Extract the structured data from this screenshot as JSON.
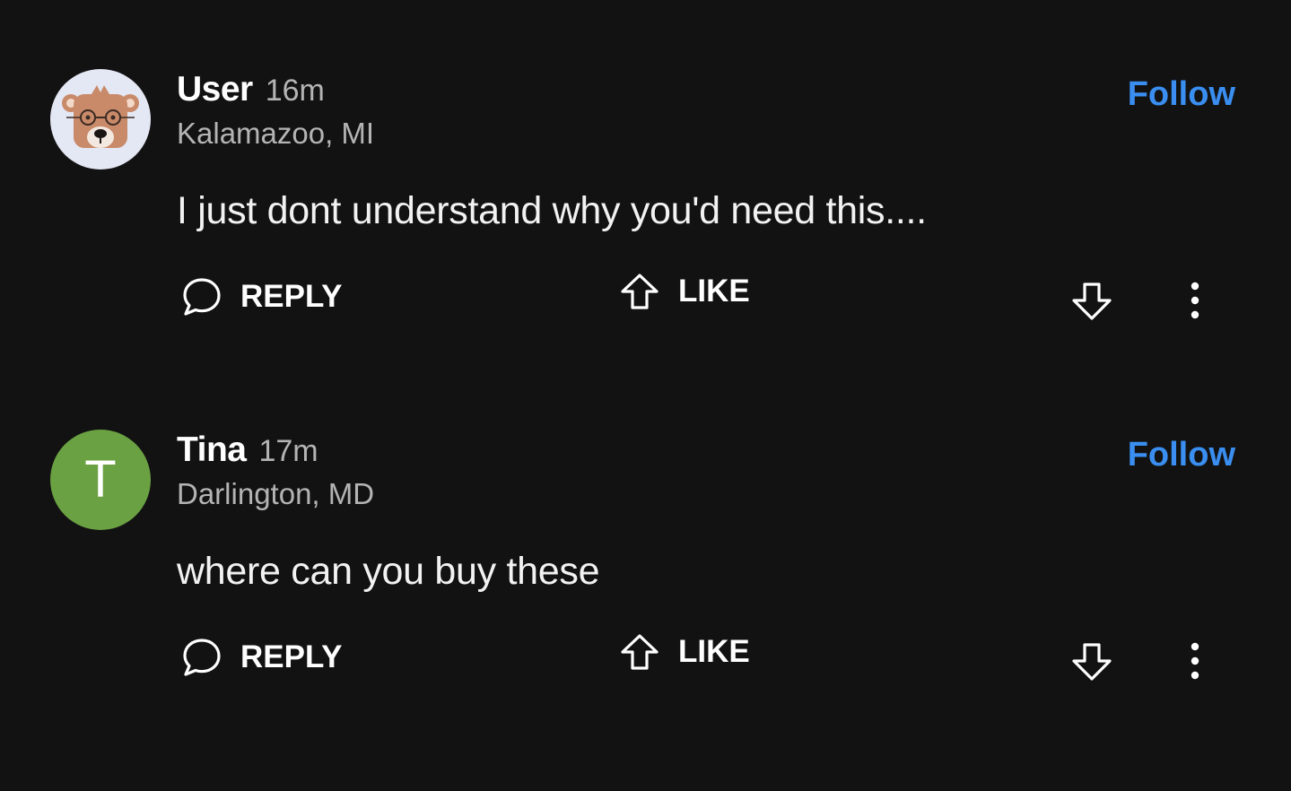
{
  "comments": [
    {
      "author": "User",
      "time": "16m",
      "location": "Kalamazoo, MI",
      "avatar": {
        "type": "bear-illustration",
        "background": "#e4e7f4"
      },
      "follow_label": "Follow",
      "text": "I just dont understand why you'd need this....",
      "reply_label": "REPLY",
      "like_label": "LIKE",
      "icons": [
        "comment-bubble-icon",
        "upvote-arrow-icon",
        "downvote-arrow-icon",
        "more-vertical-icon"
      ]
    },
    {
      "author": "Tina",
      "time": "17m",
      "location": "Darlington, MD",
      "avatar": {
        "type": "letter",
        "letter": "T",
        "background": "#6aa142"
      },
      "follow_label": "Follow",
      "text": "where can you buy these",
      "reply_label": "REPLY",
      "like_label": "LIKE",
      "icons": [
        "comment-bubble-icon",
        "upvote-arrow-icon",
        "downvote-arrow-icon",
        "more-vertical-icon"
      ]
    }
  ],
  "colors": {
    "background": "#121212",
    "follow": "#3a8ef0",
    "secondary_text": "#b4b4b4"
  }
}
